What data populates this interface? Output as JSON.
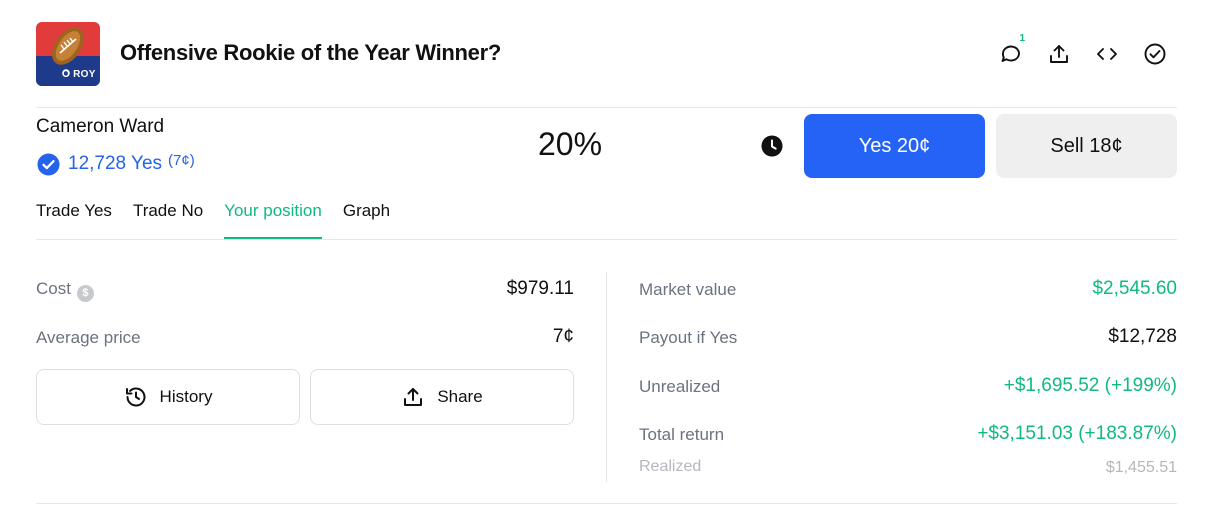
{
  "market": {
    "title": "Offensive Rookie of the Year Winner?",
    "logo_text": "O ROY",
    "comment_count": "1"
  },
  "outcome": {
    "name": "Cameron Ward",
    "shares_text": "12,728 Yes",
    "avg_text": "(7¢)",
    "probability": "20%",
    "yes_button": "Yes 20¢",
    "sell_button": "Sell 18¢"
  },
  "tabs": [
    {
      "label": "Trade Yes",
      "active": false
    },
    {
      "label": "Trade No",
      "active": false
    },
    {
      "label": "Your position",
      "active": true
    },
    {
      "label": "Graph",
      "active": false
    }
  ],
  "position": {
    "cost_label": "Cost",
    "cost_value": "$979.11",
    "avg_price_label": "Average price",
    "avg_price_value": "7¢",
    "history_button": "History",
    "share_button": "Share",
    "market_value_label": "Market value",
    "market_value": "$2,545.60",
    "payout_label": "Payout if Yes",
    "payout_value": "$12,728",
    "unrealized_label": "Unrealized",
    "unrealized_value": "+$1,695.52 (+199%)",
    "total_return_label": "Total return",
    "total_return_value": "+$3,151.03 (+183.87%)",
    "realized_label": "Realized",
    "realized_value": "$1,455.51"
  },
  "icons": {
    "comment": "comment-icon",
    "share": "share-icon",
    "embed": "embed-icon",
    "check": "check-circle-icon",
    "clock": "clock-icon",
    "verified": "verified-check-icon",
    "history": "history-icon",
    "dollar": "dollar-icon"
  },
  "colors": {
    "accent_blue": "#2463f5",
    "link_blue": "#2563eb",
    "positive_green": "#10b981",
    "sell_bg": "#efefef"
  }
}
